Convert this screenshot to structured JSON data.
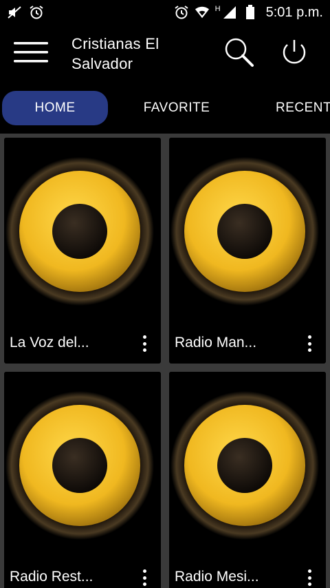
{
  "status_bar": {
    "time": "5:01 p.m.",
    "network_type": "H",
    "icons": [
      "mute-icon",
      "alarm-icon",
      "alarm-icon",
      "wifi-icon",
      "cell-signal-icon",
      "battery-icon"
    ]
  },
  "app_bar": {
    "title": "Cristianas El Salvador",
    "menu_icon": "hamburger-menu-icon",
    "search_icon": "search-icon",
    "power_icon": "power-icon"
  },
  "tabs": [
    {
      "label": "HOME",
      "active": true
    },
    {
      "label": "FAVORITE",
      "active": false
    },
    {
      "label": "RECENT",
      "active": false
    }
  ],
  "stations": [
    {
      "name": "La Voz del...",
      "art": "speaker-icon"
    },
    {
      "name": "Radio Man...",
      "art": "speaker-icon"
    },
    {
      "name": "Radio Rest...",
      "art": "speaker-icon"
    },
    {
      "name": "Radio Mesi...",
      "art": "speaker-icon"
    }
  ],
  "colors": {
    "background": "#3a3a3a",
    "bar": "#000000",
    "active_tab": "#283a85",
    "speaker_yellow": "#f2c12e"
  }
}
